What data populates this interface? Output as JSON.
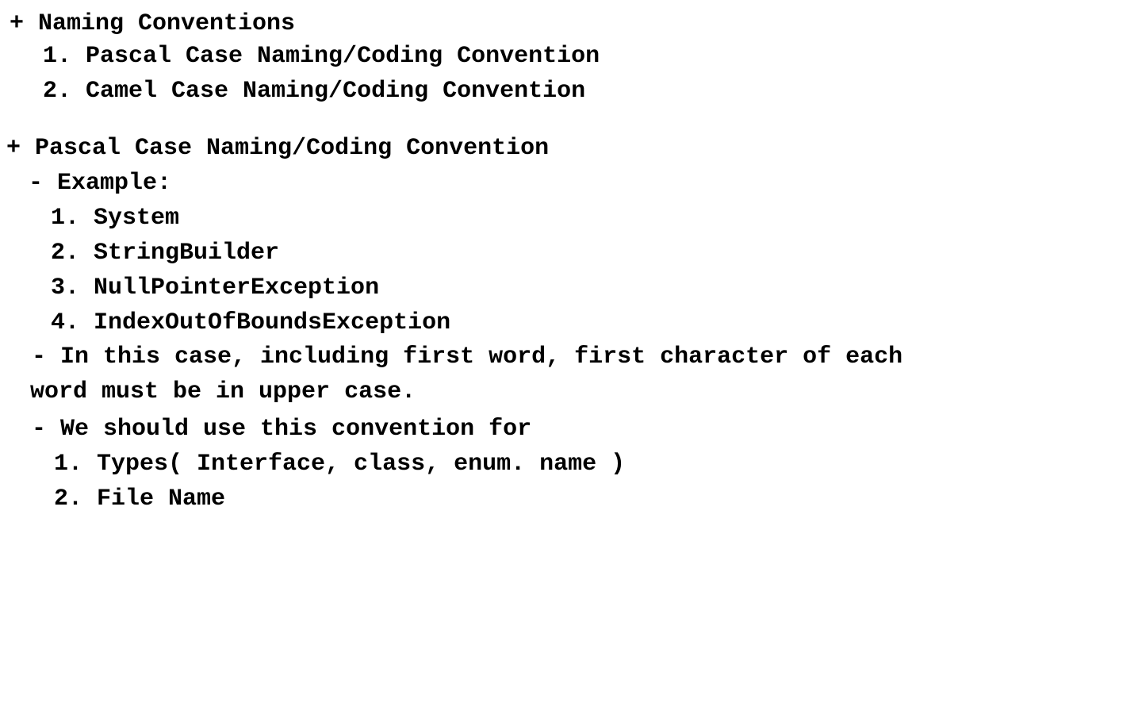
{
  "naming_conventions": {
    "heading": "+ Naming Conventions",
    "items": [
      "1. Pascal Case Naming/Coding Convention",
      "2. Camel Case Naming/Coding Convention"
    ]
  },
  "pascal_case": {
    "heading": "+ Pascal Case Naming/Coding Convention",
    "example_label": "- Example:",
    "examples": [
      "1. System",
      "2. StringBuilder",
      "3. NullPointerException",
      "4. IndexOutOfBoundsException"
    ],
    "rule_line_1": "- In this case, including first word, first character of each",
    "rule_line_2": "word must be in upper case.",
    "usage_label": "- We should use this convention for",
    "usage_items": [
      "1. Types( Interface, class, enum. name )",
      "2. File Name"
    ]
  }
}
